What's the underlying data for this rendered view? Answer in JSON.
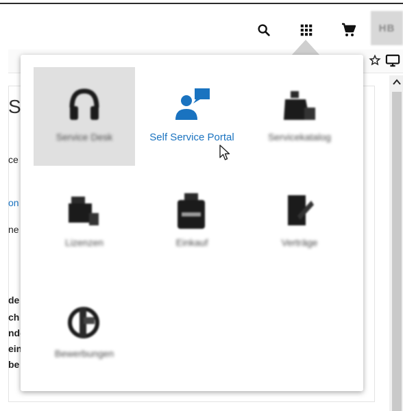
{
  "header": {
    "icons": [
      "search-icon",
      "apps-grid-icon",
      "cart-icon"
    ],
    "avatar_initials": "HB"
  },
  "background_page": {
    "text_fragments": [
      "Se",
      "ce",
      "on",
      "ne",
      "de",
      "ch",
      "nde",
      "ein",
      "be"
    ]
  },
  "launcher": {
    "apps": [
      {
        "label": "Service Desk",
        "icon": "headset-icon"
      },
      {
        "label": "Self Service Portal",
        "icon": "person-chat-icon"
      },
      {
        "label": "Servicekatalog",
        "icon": "bag-icon"
      },
      {
        "label": "Lizenzen",
        "icon": "license-icon"
      },
      {
        "label": "Einkauf",
        "icon": "briefcase-icon"
      },
      {
        "label": "Verträge",
        "icon": "contract-icon"
      },
      {
        "label": "Bewerbungen",
        "icon": "globe-icon"
      }
    ],
    "selected_index": 0,
    "hover_index": 1
  },
  "colors": {
    "accent": "#1a73c0",
    "selected_tile": "#e0e0e0"
  }
}
